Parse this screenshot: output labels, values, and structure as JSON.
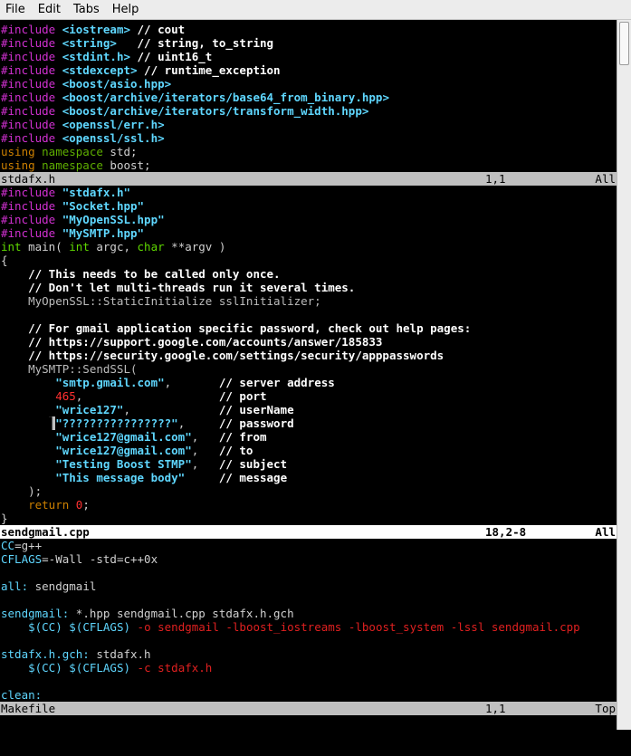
{
  "menu": [
    "File",
    "Edit",
    "Tabs",
    "Help"
  ],
  "panes": [
    {
      "status": {
        "name": "stdafx.h",
        "position": "1,1",
        "scroll": "All",
        "active": false
      },
      "lines": [
        [
          [
            "pre",
            "#include "
          ],
          [
            "str",
            "<iostream>"
          ],
          [
            "com",
            " // cout"
          ]
        ],
        [
          [
            "pre",
            "#include "
          ],
          [
            "str",
            "<string>"
          ],
          [
            "com",
            "   // string, to_string"
          ]
        ],
        [
          [
            "pre",
            "#include "
          ],
          [
            "str",
            "<stdint.h>"
          ],
          [
            "com",
            " // uint16_t"
          ]
        ],
        [
          [
            "pre",
            "#include "
          ],
          [
            "str",
            "<stdexcept>"
          ],
          [
            "com",
            " // runtime_exception"
          ]
        ],
        [
          [
            "pre",
            "#include "
          ],
          [
            "str",
            "<boost/asio.hpp>"
          ]
        ],
        [
          [
            "pre",
            "#include "
          ],
          [
            "str",
            "<boost/archive/iterators/base64_from_binary.hpp>"
          ]
        ],
        [
          [
            "pre",
            "#include "
          ],
          [
            "str",
            "<boost/archive/iterators/transform_width.hpp>"
          ]
        ],
        [
          [
            "pre",
            "#include "
          ],
          [
            "str",
            "<openssl/err.h>"
          ]
        ],
        [
          [
            "pre",
            "#include "
          ],
          [
            "str",
            "<openssl/ssl.h>"
          ]
        ],
        [
          [
            "kwo",
            "using "
          ],
          [
            "kw",
            "namespace"
          ],
          [
            "norm",
            " std;"
          ]
        ],
        [
          [
            "kwo",
            "using "
          ],
          [
            "kw",
            "namespace"
          ],
          [
            "norm",
            " boost;"
          ]
        ]
      ]
    },
    {
      "status": {
        "name": "sendgmail.cpp",
        "position": "18,2-8",
        "scroll": "All",
        "active": true
      },
      "lines": [
        [
          [
            "pre",
            "#include "
          ],
          [
            "str",
            "\"stdafx.h\""
          ]
        ],
        [
          [
            "pre",
            "#include "
          ],
          [
            "str",
            "\"Socket.hpp\""
          ]
        ],
        [
          [
            "pre",
            "#include "
          ],
          [
            "str",
            "\"MyOpenSSL.hpp\""
          ]
        ],
        [
          [
            "pre",
            "#include "
          ],
          [
            "str",
            "\"MySMTP.hpp\""
          ]
        ],
        [
          [
            "type",
            "int"
          ],
          [
            "norm",
            " main( "
          ],
          [
            "type",
            "int"
          ],
          [
            "norm",
            " argc, "
          ],
          [
            "type",
            "char"
          ],
          [
            "norm",
            " **argv )"
          ]
        ],
        [
          [
            "norm",
            "{"
          ]
        ],
        [
          [
            "com",
            "    // This needs to be called only once."
          ]
        ],
        [
          [
            "com",
            "    // Don't let multi-threads run it several times."
          ]
        ],
        [
          [
            "cls",
            "    MyOpenSSL::StaticInitialize sslInitializer;"
          ]
        ],
        [
          [
            "norm",
            ""
          ]
        ],
        [
          [
            "com",
            "    // For gmail application specific password, check out help pages:"
          ]
        ],
        [
          [
            "com",
            "    // https://support.google.com/accounts/answer/185833"
          ]
        ],
        [
          [
            "com",
            "    // https://security.google.com/settings/security/apppasswords"
          ]
        ],
        [
          [
            "cls",
            "    MySMTP::SendSSL("
          ]
        ],
        [
          [
            "str",
            "        \"smtp.gmail.com\""
          ],
          [
            "norm",
            ",       "
          ],
          [
            "com",
            "// server address"
          ]
        ],
        [
          [
            "num",
            "        465"
          ],
          [
            "norm",
            ",                    "
          ],
          [
            "com",
            "// port"
          ]
        ],
        [
          [
            "str",
            "        \"wrice127\""
          ],
          [
            "norm",
            ",             "
          ],
          [
            "com",
            "// userName"
          ]
        ],
        [
          [
            "norm",
            "       "
          ],
          [
            "cur",
            "▌"
          ],
          [
            "str",
            "\"????????????????\""
          ],
          [
            "norm",
            ",     "
          ],
          [
            "com",
            "// password"
          ]
        ],
        [
          [
            "str",
            "        \"wrice127@gmail.com\""
          ],
          [
            "norm",
            ",   "
          ],
          [
            "com",
            "// from"
          ]
        ],
        [
          [
            "str",
            "        \"wrice127@gmail.com\""
          ],
          [
            "norm",
            ",   "
          ],
          [
            "com",
            "// to"
          ]
        ],
        [
          [
            "str",
            "        \"Testing Boost STMP\""
          ],
          [
            "norm",
            ",   "
          ],
          [
            "com",
            "// subject"
          ]
        ],
        [
          [
            "str",
            "        \"This message body\""
          ],
          [
            "norm",
            "     "
          ],
          [
            "com",
            "// message"
          ]
        ],
        [
          [
            "norm",
            "    );"
          ]
        ],
        [
          [
            "kwo",
            "    return "
          ],
          [
            "num",
            "0"
          ],
          [
            "norm",
            ";"
          ]
        ],
        [
          [
            "norm",
            "}"
          ]
        ]
      ]
    },
    {
      "status": {
        "name": "Makefile",
        "position": "1,1",
        "scroll": "Top",
        "active": false
      },
      "lines": [
        [
          [
            "mkvar",
            "CC"
          ],
          [
            "norm",
            "=g++"
          ]
        ],
        [
          [
            "mkvar",
            "CFLAGS"
          ],
          [
            "norm",
            "=-Wall -std=c++0x"
          ]
        ],
        [
          [
            "norm",
            ""
          ]
        ],
        [
          [
            "mkrule",
            "all:"
          ],
          [
            "norm",
            " sendgmail"
          ]
        ],
        [
          [
            "norm",
            ""
          ]
        ],
        [
          [
            "mkrule",
            "sendgmail:"
          ],
          [
            "norm",
            " *.hpp sendgmail.cpp stdafx.h.gch"
          ]
        ],
        [
          [
            "norm",
            "    "
          ],
          [
            "mkvar",
            "$(CC)"
          ],
          [
            "norm",
            " "
          ],
          [
            "mkvar",
            "$(CFLAGS)"
          ],
          [
            "mkarg",
            " -o sendgmail -lboost_iostreams -lboost_system -lssl sendgmail.cpp"
          ]
        ],
        [
          [
            "norm",
            ""
          ]
        ],
        [
          [
            "mkrule",
            "stdafx.h.gch:"
          ],
          [
            "norm",
            " stdafx.h"
          ]
        ],
        [
          [
            "norm",
            "    "
          ],
          [
            "mkvar",
            "$(CC)"
          ],
          [
            "norm",
            " "
          ],
          [
            "mkvar",
            "$(CFLAGS)"
          ],
          [
            "mkarg",
            " -c stdafx.h"
          ]
        ],
        [
          [
            "norm",
            ""
          ]
        ],
        [
          [
            "mkrule",
            "clean:"
          ]
        ]
      ]
    }
  ]
}
